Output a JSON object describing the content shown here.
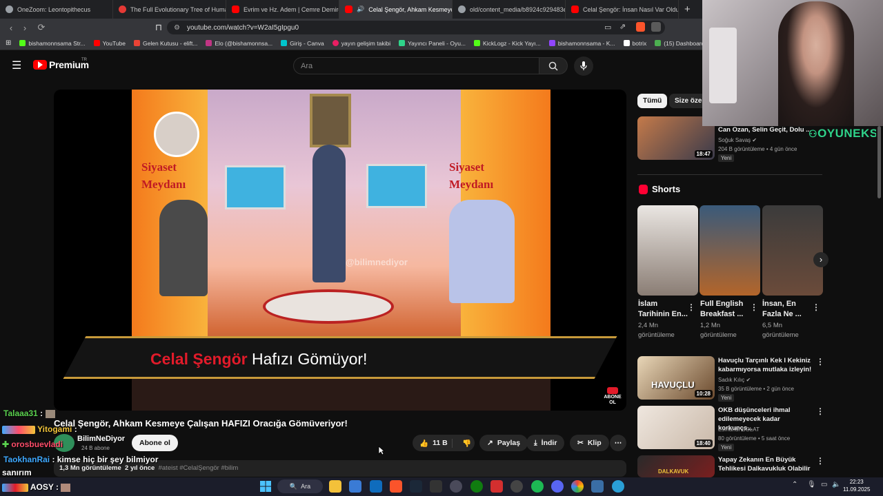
{
  "browser": {
    "tabs": [
      {
        "title": "OneZoom: Leontopithecus",
        "color": "#9aa0a6"
      },
      {
        "title": "The Full Evolutionary Tree of Human...",
        "color": "#e53935"
      },
      {
        "title": "Evrim ve Hz. Adem | Cemre Demirel...",
        "color": "#ff0000"
      },
      {
        "title": "Celal Şengör, Ahkam Kesmeye...",
        "color": "#ff0000",
        "active": true
      },
      {
        "title": "old/content_media/b8924c929483e3...",
        "color": "#9aa0a6"
      },
      {
        "title": "Celal Şengör: İnsan Nasıl Var Oldu? ...",
        "color": "#ff0000"
      }
    ],
    "new_tab": "+",
    "close_glyph": "✕",
    "url": "youtube.com/watch?v=W2aI5gIpgu0",
    "bookmarks": [
      {
        "label": "bishamonnsama Str...",
        "color": "#53fc18"
      },
      {
        "label": "YouTube",
        "color": "#ff0000"
      },
      {
        "label": "Gelen Kutusu - elift...",
        "color": "#ea4335"
      },
      {
        "label": "Elo (@bishamonnsa...",
        "color": "#c13584"
      },
      {
        "label": "Giriş - Canva",
        "color": "#00c4cc"
      },
      {
        "label": "yayın gelişim takibi",
        "color": "#e91e63"
      },
      {
        "label": "Yayıncı Paneli - Oyu...",
        "color": "#2fd38a"
      },
      {
        "label": "KickLogz - Kick Yayı...",
        "color": "#53fc18"
      },
      {
        "label": "bishamonnsama - K...",
        "color": "#9146ff"
      },
      {
        "label": "botrix",
        "color": "#ffffff"
      },
      {
        "label": "(15) Dashboard / Str...",
        "color": "#4caf50"
      }
    ]
  },
  "youtube": {
    "logo_text": "Premium",
    "logo_sup": "TR",
    "search_placeholder": "Ara",
    "video_title": "Celal Şengör, Ahkam Kesmeye Çalışan HAFIZI Oracığa Gömüveriyor!",
    "video_overlay": {
      "red": "Celal Şengör",
      "white": "Hafızı Gömüyor!"
    },
    "siyaset_left": "Siyaset\nMeydanı",
    "siyaset_right": "Siyaset\nMeydanı",
    "watermark": "@bilimnediyor",
    "abone_badge": "ABONE\nOL",
    "channel": {
      "name": "BilimNeDiyor",
      "subs": "24 B abone",
      "subscribe": "Abone ol"
    },
    "actions": {
      "likes": "11 B",
      "share": "Paylaş",
      "download": "İndir",
      "clip": "Klip"
    },
    "description": {
      "views": "1,3 Mn görüntüleme",
      "age": "2 yıl önce",
      "tags": "#ateist #CelalŞengör #bilim"
    }
  },
  "sidebar": {
    "chips": [
      "Tümü",
      "Size özel"
    ],
    "top_video": {
      "title": "Can Ozan, Selin Geçit, Dolu ...",
      "channel": "Soğuk Savaş",
      "meta": "204 B görüntüleme • 4 gün önce",
      "badge": "Yeni",
      "duration": "18:47"
    },
    "shorts_heading": "Shorts",
    "shorts": [
      {
        "title": "İslam Tarihinin En...",
        "views": "2,4 Mn görüntüleme",
        "color": "#8a7d74"
      },
      {
        "title": "Full English Breakfast ...",
        "views": "1,2 Mn görüntüleme",
        "color": "#b3652a"
      },
      {
        "title": "İnsan, En Fazla Ne ...",
        "views": "6,5 Mn görüntüleme",
        "color": "#6b4b3a"
      }
    ],
    "videos": [
      {
        "title": "Havuçlu Tarçınlı Kek I Kekiniz kabarmıyorsa mutlaka izleyin!",
        "channel": "Sadık Kılıç",
        "meta": "35 B görüntüleme • 2 gün önce",
        "badge": "Yeni",
        "duration": "10:28",
        "thumb_text": "HAVUÇLU",
        "color": "#6b4a2e"
      },
      {
        "title": "OKB düşünceleri ihmal edilemeyecek kadar korkunçs...",
        "channel": "Esmanur BOLAT",
        "meta": "80 görüntüleme • 5 saat önce",
        "badge": "Yeni",
        "duration": "18:40",
        "color": "#c9b8a8"
      },
      {
        "title": "Yapay Zekanın En Büyük Tehlikesi Dalkavukluk Olabilir ...",
        "color": "#7a1f1f",
        "thumb_text": "DALKAVUK"
      }
    ]
  },
  "chat": [
    {
      "user": "Talaaa31",
      "sep": " : ",
      "msg": "",
      "color": "#5bd14f"
    },
    {
      "user": "Yitogami",
      "sep": " : ",
      "msg": "",
      "color": "#f0c43a"
    },
    {
      "user": "orosbuevladi",
      "sep": "",
      "msg": "",
      "color": "#ff4d6a"
    },
    {
      "user": "TaokhanRai",
      "sep": " : ",
      "msg": "kimse hiç bir şey bilmiyor",
      "color": "#3fa9ff"
    },
    {
      "user": "",
      "sep": "",
      "msg": "sanırım",
      "color": "#ffffff"
    },
    {
      "user": "AOSY",
      "sep": " : ",
      "msg": "",
      "color": "#ffffff"
    }
  ],
  "overlay": {
    "brand": "OYUNEKS"
  },
  "taskbar": {
    "search": "Ara",
    "time": "22:23",
    "date": "11.09.2025"
  }
}
